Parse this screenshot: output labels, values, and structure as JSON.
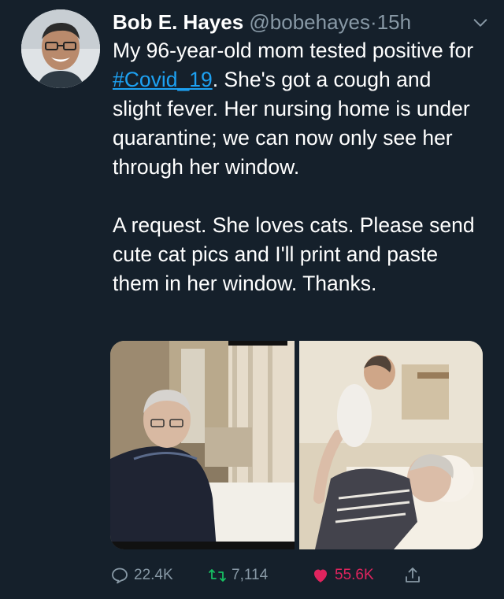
{
  "tweet": {
    "author_name": "Bob E. Hayes",
    "handle": "@bobehayes",
    "separator": "·",
    "time": "15h",
    "text_line1_before": "My 96-year-old mom tested positive for ",
    "hashtag": "#Covid_19",
    "text_line1_after": ". She's got a cough and slight fever. Her nursing home is under quarantine; we can now only see her through her window.",
    "text_paragraph2": "A request. She loves cats. Please send cute cat pics and I'll print and paste them in her window. Thanks."
  },
  "stats": {
    "replies": "22.4K",
    "retweets": "7,114",
    "likes": "55.6K"
  },
  "icons": {
    "avatar": "avatar-photo",
    "menu": "chevron-down-icon",
    "reply": "reply-icon",
    "retweet": "retweet-icon",
    "like": "heart-icon",
    "share": "share-icon"
  },
  "colors": {
    "background": "#15202b",
    "link": "#1da1f2",
    "muted": "#8899a6",
    "like": "#e0245e"
  }
}
